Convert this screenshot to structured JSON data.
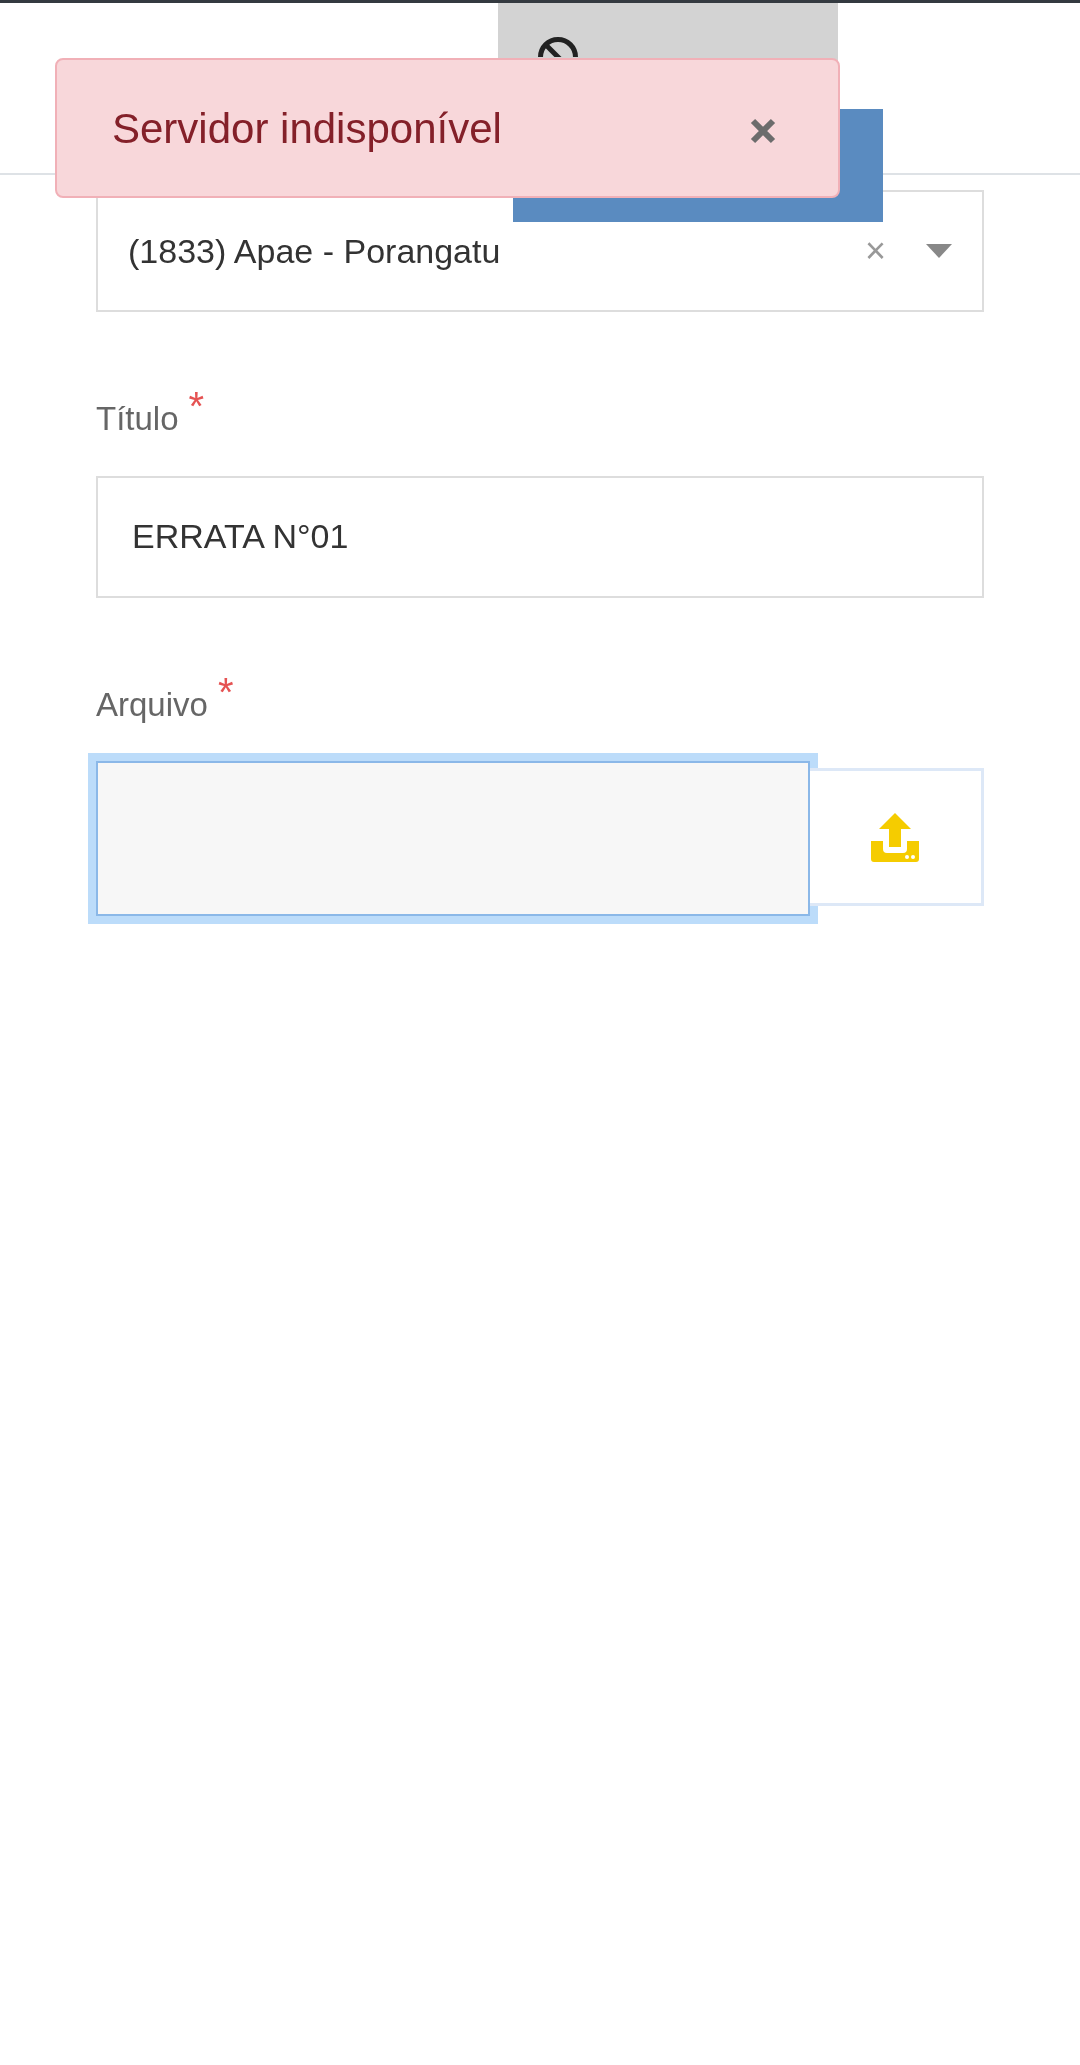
{
  "alert": {
    "message": "Servidor indisponível"
  },
  "fields": [
    {
      "kind": "select",
      "value": "(1833) Apae - Porangatu",
      "clear": "×"
    },
    {
      "kind": "text",
      "label": "Título",
      "required_mark": "*",
      "value": "ERRATA N°01"
    },
    {
      "kind": "file",
      "label": "Arquivo",
      "required_mark": "*",
      "focused": true
    }
  ]
}
